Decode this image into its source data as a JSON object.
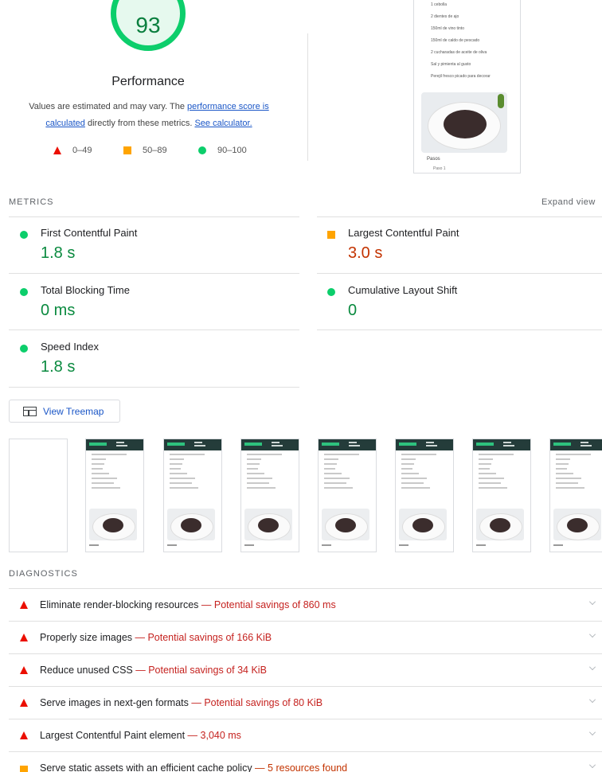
{
  "score": {
    "value": "93",
    "title": "Performance",
    "note_prefix": "Values are estimated and may vary. The ",
    "note_link1": "performance score is calculated",
    "note_middle": " directly from these metrics. ",
    "note_link2": "See calculator."
  },
  "legend": [
    {
      "range": "0–49",
      "icon": "fail-triangle-icon"
    },
    {
      "range": "50–89",
      "icon": "average-square-icon"
    },
    {
      "range": "90–100",
      "icon": "pass-circle-icon"
    }
  ],
  "final_screenshot": {
    "lines": [
      "1 cebolla",
      "2 dientes de ajo",
      "150ml de vino tinto",
      "150ml de caldo de pescado",
      "2 cucharadas de aceite de oliva",
      "Sal y pimienta al gusto",
      "Perejil fresco picado para decorar"
    ],
    "steps_label": "Pasos",
    "step1": "Paso 1"
  },
  "metrics": {
    "header": "METRICS",
    "expand_label": "Expand view",
    "items": [
      {
        "name": "First Contentful Paint",
        "value": "1.8 s",
        "status": "pass"
      },
      {
        "name": "Largest Contentful Paint",
        "value": "3.0 s",
        "status": "average"
      },
      {
        "name": "Total Blocking Time",
        "value": "0 ms",
        "status": "pass"
      },
      {
        "name": "Cumulative Layout Shift",
        "value": "0",
        "status": "pass"
      },
      {
        "name": "Speed Index",
        "value": "1.8 s",
        "status": "pass"
      }
    ]
  },
  "treemap": {
    "label": "View Treemap"
  },
  "diagnostics": {
    "header": "DIAGNOSTICS",
    "items": [
      {
        "title": "Eliminate render-blocking resources",
        "detail": "Potential savings of 860 ms",
        "status": "fail"
      },
      {
        "title": "Properly size images",
        "detail": "Potential savings of 166 KiB",
        "status": "fail"
      },
      {
        "title": "Reduce unused CSS",
        "detail": "Potential savings of 34 KiB",
        "status": "fail"
      },
      {
        "title": "Serve images in next-gen formats",
        "detail": "Potential savings of 80 KiB",
        "status": "fail"
      },
      {
        "title": "Largest Contentful Paint element",
        "detail": "3,040 ms",
        "status": "fail"
      },
      {
        "title": "Serve static assets with an efficient cache policy",
        "detail": "5 resources found",
        "status": "average"
      }
    ]
  },
  "colors": {
    "pass": "#0cce6b",
    "average": "#ffa400",
    "fail": "#eb0f00",
    "link": "#1a56c7"
  }
}
